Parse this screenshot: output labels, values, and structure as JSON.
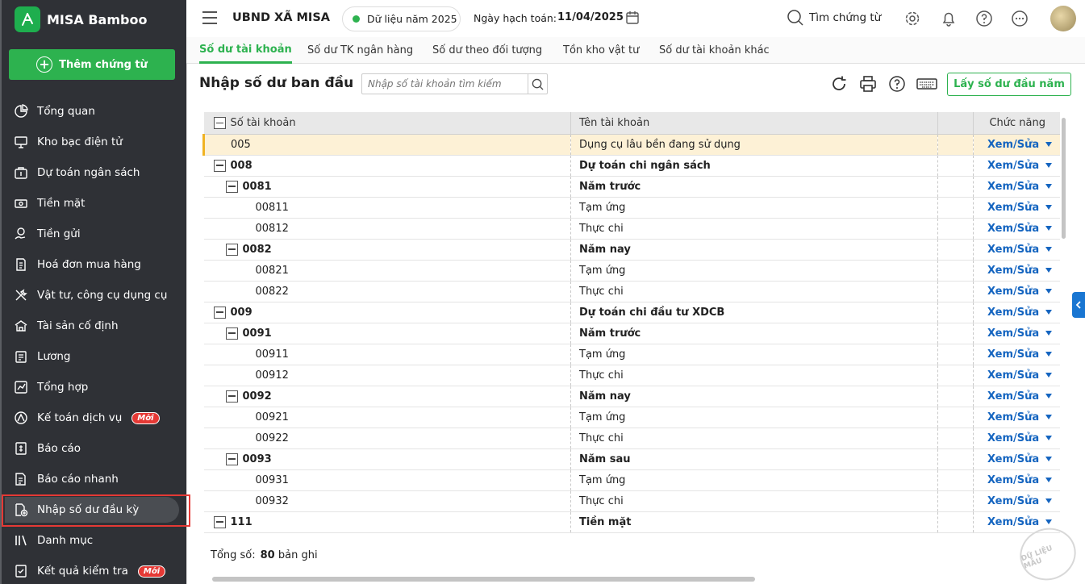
{
  "brand": {
    "name": "MISA Bamboo"
  },
  "sidebar": {
    "add_label": "Thêm chứng từ",
    "items": [
      {
        "label": "Tổng quan",
        "icon": "pie-chart-icon"
      },
      {
        "label": "Kho bạc điện tử",
        "icon": "monitor-icon"
      },
      {
        "label": "Dự toán ngân sách",
        "icon": "budget-icon"
      },
      {
        "label": "Tiền mặt",
        "icon": "cash-icon"
      },
      {
        "label": "Tiền gửi",
        "icon": "deposit-icon"
      },
      {
        "label": "Hoá đơn mua hàng",
        "icon": "invoice-icon"
      },
      {
        "label": "Vật tư, công cụ dụng cụ",
        "icon": "tools-icon"
      },
      {
        "label": "Tài sản cố định",
        "icon": "building-icon"
      },
      {
        "label": "Lương",
        "icon": "salary-icon"
      },
      {
        "label": "Tổng hợp",
        "icon": "summary-icon"
      },
      {
        "label": "Kế toán dịch vụ",
        "icon": "service-icon",
        "badge": "Mới"
      },
      {
        "label": "Báo cáo",
        "icon": "report-icon"
      },
      {
        "label": "Báo cáo nhanh",
        "icon": "quick-report-icon"
      },
      {
        "label": "Nhập số dư đầu kỳ",
        "icon": "opening-balance-icon",
        "active": true
      },
      {
        "label": "Danh mục",
        "icon": "catalog-icon"
      },
      {
        "label": "Kết quả kiểm tra",
        "icon": "check-result-icon",
        "badge": "Mới"
      }
    ]
  },
  "header": {
    "org": "UBND XÃ MISA",
    "year": "Dữ liệu năm 2025",
    "date_label": "Ngày hạch toán:",
    "date_value": "11/04/2025",
    "search_label": "Tìm chứng từ"
  },
  "tabs": [
    {
      "label": "Số dư tài khoản",
      "active": true
    },
    {
      "label": "Số dư TK ngân hàng"
    },
    {
      "label": "Số dư theo đối tượng"
    },
    {
      "label": "Tồn kho vật tư"
    },
    {
      "label": "Số dư tài khoản khác"
    }
  ],
  "toolbar": {
    "title": "Nhập số dư ban đầu",
    "search_placeholder": "Nhập số tài khoản tìm kiếm",
    "get_button": "Lấy số dư đầu năm"
  },
  "table": {
    "headers": {
      "account": "Số tài khoản",
      "name": "Tên tài khoản",
      "blank": "",
      "action": "Chức năng"
    },
    "action_label": "Xem/Sửa",
    "rows": [
      {
        "account": "005",
        "name": "Dụng cụ lâu bền đang sử dụng",
        "level": 1,
        "bold": false,
        "toggle": false,
        "highlight": true
      },
      {
        "account": "008",
        "name": "Dự toán chi ngân sách",
        "level": 0,
        "bold": true,
        "toggle": true
      },
      {
        "account": "0081",
        "name": "Năm trước",
        "level": 1,
        "bold": true,
        "toggle": true
      },
      {
        "account": "00811",
        "name": "Tạm ứng",
        "level": 2,
        "bold": false,
        "toggle": false
      },
      {
        "account": "00812",
        "name": "Thực chi",
        "level": 2,
        "bold": false,
        "toggle": false
      },
      {
        "account": "0082",
        "name": "Năm nay",
        "level": 1,
        "bold": true,
        "toggle": true
      },
      {
        "account": "00821",
        "name": "Tạm ứng",
        "level": 2,
        "bold": false,
        "toggle": false
      },
      {
        "account": "00822",
        "name": "Thực chi",
        "level": 2,
        "bold": false,
        "toggle": false
      },
      {
        "account": "009",
        "name": "Dự toán chi đầu tư XDCB",
        "level": 0,
        "bold": true,
        "toggle": true
      },
      {
        "account": "0091",
        "name": "Năm trước",
        "level": 1,
        "bold": true,
        "toggle": true
      },
      {
        "account": "00911",
        "name": "Tạm ứng",
        "level": 2,
        "bold": false,
        "toggle": false
      },
      {
        "account": "00912",
        "name": "Thực chi",
        "level": 2,
        "bold": false,
        "toggle": false
      },
      {
        "account": "0092",
        "name": "Năm nay",
        "level": 1,
        "bold": true,
        "toggle": true
      },
      {
        "account": "00921",
        "name": "Tạm ứng",
        "level": 2,
        "bold": false,
        "toggle": false
      },
      {
        "account": "00922",
        "name": "Thực chi",
        "level": 2,
        "bold": false,
        "toggle": false
      },
      {
        "account": "0093",
        "name": "Năm sau",
        "level": 1,
        "bold": true,
        "toggle": true
      },
      {
        "account": "00931",
        "name": "Tạm ứng",
        "level": 2,
        "bold": false,
        "toggle": false
      },
      {
        "account": "00932",
        "name": "Thực chi",
        "level": 2,
        "bold": false,
        "toggle": false
      },
      {
        "account": "111",
        "name": "Tiền mặt",
        "level": 0,
        "bold": true,
        "toggle": true
      }
    ]
  },
  "footer": {
    "total_label": "Tổng số:",
    "total_count": "80",
    "total_unit": "bản ghi"
  },
  "watermark": "DỮ LIỆU MẪU",
  "colors": {
    "brand_green": "#2db24f",
    "sidebar_bg": "#2f3136",
    "link_blue": "#1565c0",
    "highlight": "#fdf1d6",
    "active_border": "#e53935"
  }
}
